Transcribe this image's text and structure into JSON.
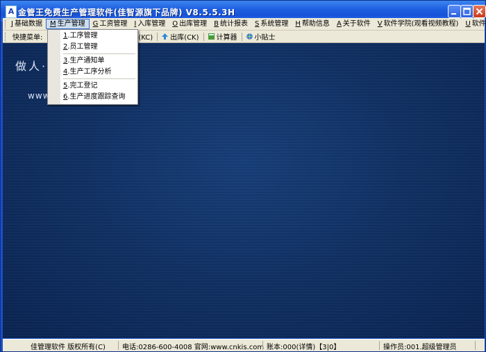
{
  "window": {
    "title": "金管王免费生产管理软件(佳智源旗下品牌) V8.5.5.3H",
    "icon_letter": "A"
  },
  "menubar": {
    "items": [
      {
        "key": "J",
        "label": "基础数据"
      },
      {
        "key": "M",
        "label": "生产管理"
      },
      {
        "key": "G",
        "label": "工资管理"
      },
      {
        "key": "I",
        "label": "入库管理"
      },
      {
        "key": "O",
        "label": "出库管理"
      },
      {
        "key": "B",
        "label": "统计报表"
      },
      {
        "key": "S",
        "label": "系统管理"
      },
      {
        "key": "H",
        "label": "帮助信息"
      },
      {
        "key": "A",
        "label": "关于软件"
      },
      {
        "key": "V",
        "label": "软件学院(观看视频教程)"
      },
      {
        "key": "U",
        "label": "软件升级"
      }
    ]
  },
  "toolbar": {
    "label": "快捷菜单:",
    "stock_label": "存数(KC)",
    "outbound_label": "出库(CK)",
    "calculator_label": "计算器",
    "tips_label": "小贴士"
  },
  "dropdown": {
    "items": [
      {
        "key": "1",
        "label": ".工序管理"
      },
      {
        "key": "2",
        "label": ".员工管理"
      },
      {
        "key": "3",
        "label": ".生产通知单"
      },
      {
        "key": "4",
        "label": ".生产工序分析"
      },
      {
        "key": "5",
        "label": ".完工登记"
      },
      {
        "key": "6",
        "label": ".生产进度跟踪查询"
      }
    ]
  },
  "main": {
    "slogan": "做人·",
    "url": "www."
  },
  "statusbar": {
    "copyright": "佳管理软件 版权所有(C)",
    "contact": "电话:0286-600-4008 官网:www.cnkis.com",
    "account": "账本:000(详情)【3|0】",
    "operator": "操作员:001.超级管理员"
  },
  "colors": {
    "titlebar": "#1f5fe0",
    "background": "#0f2e60",
    "menubar": "#ece9d8"
  }
}
